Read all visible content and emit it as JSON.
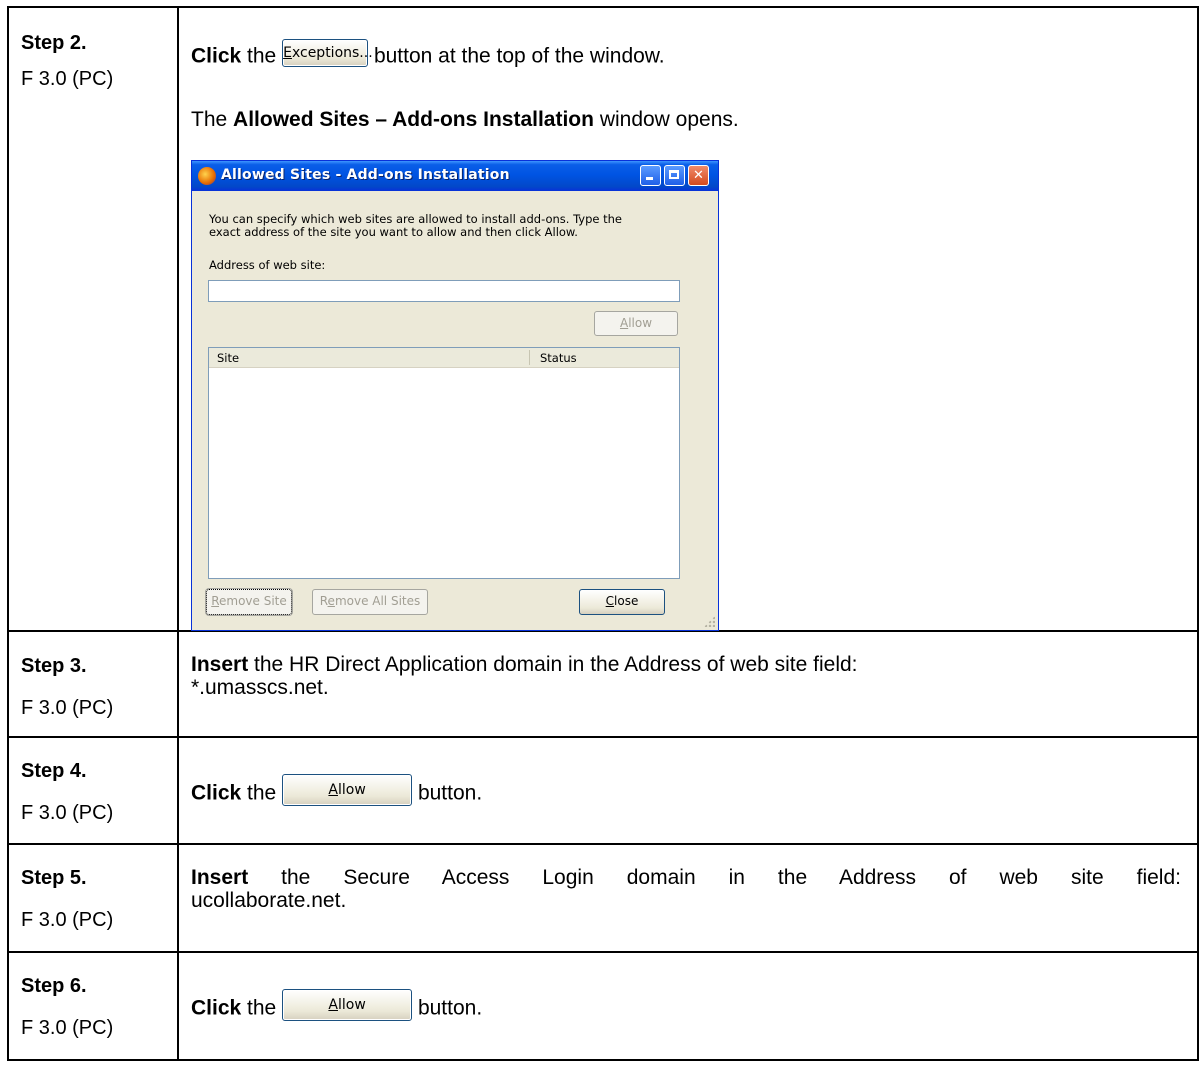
{
  "rows": [
    {
      "step": "Step 2.",
      "platform": "F 3.0 (PC)",
      "click_word": "Click",
      "the_word": "the",
      "button_label": "Exceptions...",
      "after_button": "button at the top of the window.",
      "line2_prefix": "The",
      "line2_bold": "Allowed Sites – Add-ons Installation",
      "line2_suffix": "window opens."
    },
    {
      "step": "Step 3.",
      "platform": "F 3.0 (PC)",
      "bold": "Insert",
      "text_line1": "the HR Direct Application domain in the Address of web site field:",
      "text_line2": "*.umasscs.net."
    },
    {
      "step": "Step 4.",
      "platform": "F 3.0 (PC)",
      "click_word": "Click",
      "the_word": "the",
      "button_label": "Allow",
      "after_button": "button."
    },
    {
      "step": "Step 5.",
      "platform": "F 3.0 (PC)",
      "bold": "Insert",
      "text_line1": "the Secure Access Login domain in the Address of web site field:",
      "text_line2": "ucollaborate.net."
    },
    {
      "step": "Step 6.",
      "platform": "F 3.0 (PC)",
      "click_word": "Click",
      "the_word": "the",
      "button_label": "Allow",
      "after_button": "button."
    }
  ],
  "dialog": {
    "title": "Allowed Sites - Add-ons Installation",
    "description_line1": "You can specify which web sites are allowed to install add-ons. Type the",
    "description_line2": "exact address of the site you want to allow and then click Allow.",
    "address_label": "Address of web site:",
    "address_value": "",
    "allow_label": "Allow",
    "list_headers": [
      "Site",
      "Status"
    ],
    "remove_site_label": "Remove Site",
    "remove_all_label": "Remove All Sites",
    "close_label": "Close"
  },
  "icons": {
    "app": "firefox-icon",
    "minimize": "minimize-icon",
    "maximize": "maximize-icon",
    "close": "close-icon",
    "grip": "resize-grip-icon"
  }
}
